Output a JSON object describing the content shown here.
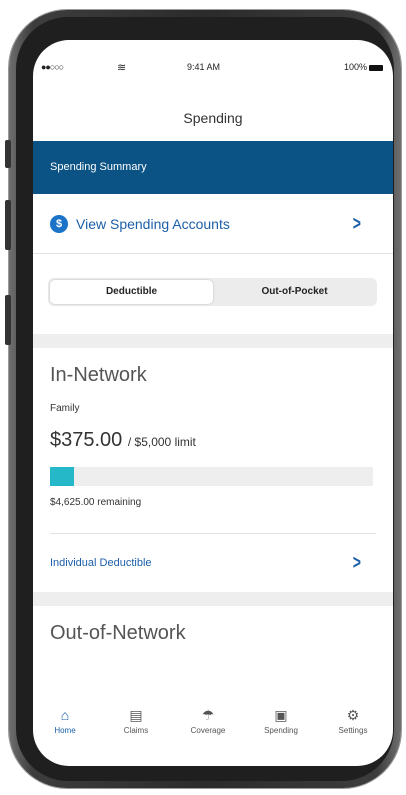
{
  "status_bar": {
    "signal": "●●○○○",
    "time": "9:41 AM",
    "battery": "100%"
  },
  "nav": {
    "title": "Spending"
  },
  "summary": {
    "title": "Spending Summary"
  },
  "spending_accounts_link": {
    "icon": "$",
    "label": "View Spending Accounts"
  },
  "segments": [
    {
      "label": "Deductible",
      "active": true
    },
    {
      "label": "Out-of-Pocket",
      "active": false
    }
  ],
  "in_network": {
    "title": "In-Network",
    "coverage": "Family",
    "amount": "$375.00",
    "limit": "/ $5,000 limit",
    "progress_fraction": 0.075,
    "remaining": "$4,625.00 remaining",
    "individual_link": "Individual Deductible"
  },
  "out_network": {
    "title": "Out-of-Network"
  },
  "tabs": [
    {
      "label": "Home",
      "icon": "home-icon",
      "active": true
    },
    {
      "label": "Claims",
      "icon": "clipboard-icon",
      "active": false
    },
    {
      "label": "Coverage",
      "icon": "umbrella-icon",
      "active": false
    },
    {
      "label": "Spending",
      "icon": "dollar-bill-icon",
      "active": false
    },
    {
      "label": "Settings",
      "icon": "gear-icon",
      "active": false
    }
  ],
  "colors": {
    "header": "#0b5384",
    "accent": "#1c5fa8",
    "progress": "#25b8c9"
  }
}
